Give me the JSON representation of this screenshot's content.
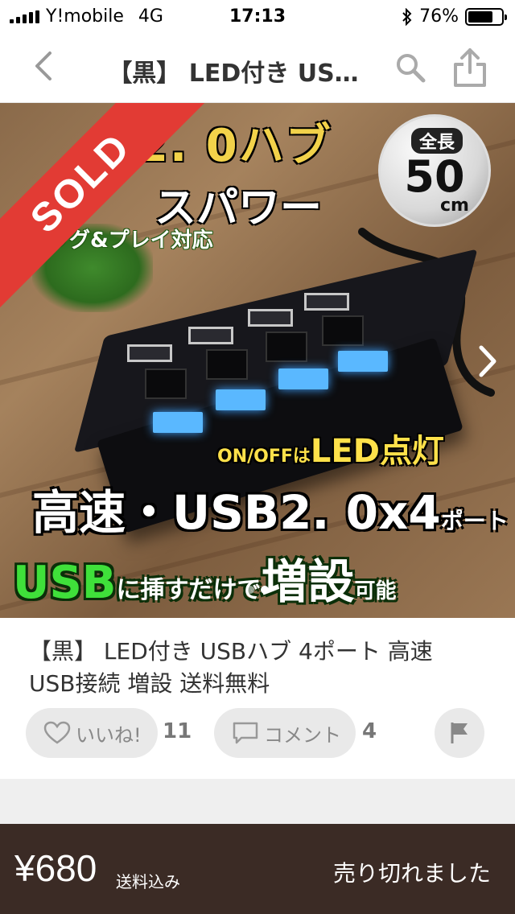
{
  "status_bar": {
    "carrier": "Y!mobile",
    "network": "4G",
    "time": "17:13",
    "battery": "76%",
    "battery_level": 0.76
  },
  "nav": {
    "title": "【黒】 LED付き US…",
    "back_icon": "chevron-left-icon",
    "search_icon": "search-icon",
    "share_icon": "share-icon"
  },
  "hero": {
    "sold_label": "SOLD",
    "banner_top": "2. 0ハブ",
    "banner_2": "スパワー",
    "banner_3": "ラグ&プレイ対応",
    "badge_line1": "全長",
    "badge_line2": "50",
    "badge_line3": "cm",
    "onoff_small": "ON/OFFは",
    "onoff_big": "LED点灯",
    "speed_main": "高速・USB2. 0x4",
    "speed_suffix": "ポート",
    "usb_word": "USB",
    "usb_mid": "に挿すだけで",
    "usb_big": "増設",
    "usb_end": "可能",
    "next_icon": "chevron-right-icon",
    "slide_count": 2,
    "active_slide": 1
  },
  "item": {
    "name": "【黒】 LED付き USBハブ 4ポート 高速 USB接続 増設 送料無料",
    "like_label": "いいね!",
    "like_count": "11",
    "comment_label": "コメント",
    "comment_count": "4",
    "flag_icon": "flag-icon"
  },
  "bottom_bar": {
    "price": "¥680",
    "shipping": "送料込み",
    "status": "売り切れました"
  },
  "colors": {
    "sold_ribbon": "#e23b34",
    "bottom_bar": "#3b2b25",
    "pill_bg": "#e9e9e9",
    "led_blue": "#5ab8ff"
  }
}
